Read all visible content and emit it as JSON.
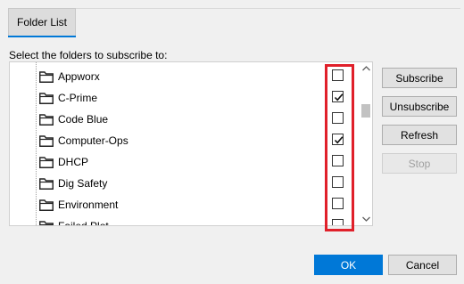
{
  "tabs": [
    {
      "label": "Folder List"
    }
  ],
  "prompt": "Select the folders to subscribe to:",
  "folders": [
    {
      "label": "Appworx",
      "checked": false
    },
    {
      "label": "C-Prime",
      "checked": true
    },
    {
      "label": "Code Blue",
      "checked": false
    },
    {
      "label": "Computer-Ops",
      "checked": true
    },
    {
      "label": "DHCP",
      "checked": false
    },
    {
      "label": "Dig Safety",
      "checked": false
    },
    {
      "label": "Environment",
      "checked": false
    },
    {
      "label": "Failed Plot",
      "checked": false
    }
  ],
  "side_buttons": {
    "subscribe": "Subscribe",
    "unsubscribe": "Unsubscribe",
    "refresh": "Refresh",
    "stop": "Stop"
  },
  "footer": {
    "ok": "OK",
    "cancel": "Cancel"
  },
  "colors": {
    "accent": "#0078d7",
    "highlight": "#e0202a"
  }
}
